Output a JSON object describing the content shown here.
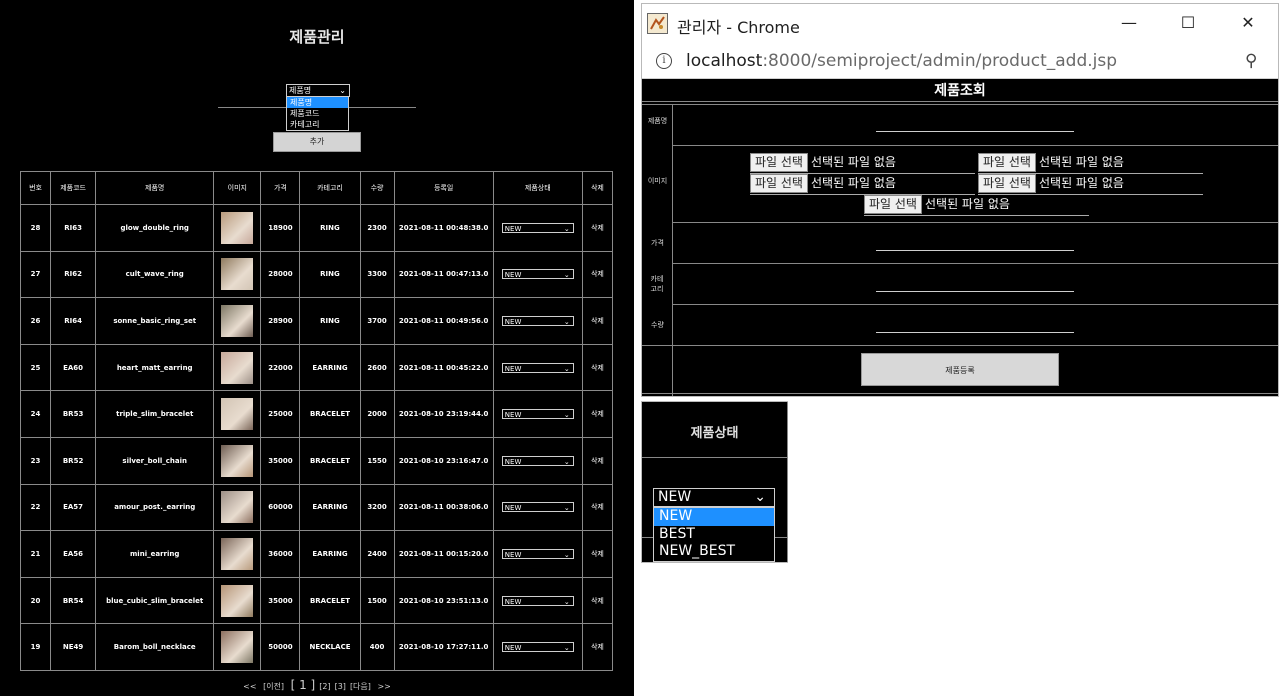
{
  "left": {
    "title": "제품관리",
    "search": {
      "selected": "제품명",
      "options": [
        "제품명",
        "제품코드",
        "카테고리"
      ]
    },
    "add_label": "추가",
    "table": {
      "headers": [
        "번호",
        "제품코드",
        "제품명",
        "이미지",
        "가격",
        "카테고리",
        "수량",
        "등록일",
        "제품상태",
        "삭제"
      ],
      "rows": [
        {
          "no": "28",
          "code": "RI63",
          "name": "glow_double_ring",
          "price": "18900",
          "category": "RING",
          "qty": "2300",
          "date": "2021-08-11 00:48:38.0",
          "status": "NEW",
          "del": "삭제"
        },
        {
          "no": "27",
          "code": "RI62",
          "name": "cult_wave_ring",
          "price": "28000",
          "category": "RING",
          "qty": "3300",
          "date": "2021-08-11 00:47:13.0",
          "status": "NEW",
          "del": "삭제"
        },
        {
          "no": "26",
          "code": "RI64",
          "name": "sonne_basic_ring_set",
          "price": "28900",
          "category": "RING",
          "qty": "3700",
          "date": "2021-08-11 00:49:56.0",
          "status": "NEW",
          "del": "삭제"
        },
        {
          "no": "25",
          "code": "EA60",
          "name": "heart_matt_earring",
          "price": "22000",
          "category": "EARRING",
          "qty": "2600",
          "date": "2021-08-11 00:45:22.0",
          "status": "NEW",
          "del": "삭제"
        },
        {
          "no": "24",
          "code": "BR53",
          "name": "triple_slim_bracelet",
          "price": "25000",
          "category": "BRACELET",
          "qty": "2000",
          "date": "2021-08-10 23:19:44.0",
          "status": "NEW",
          "del": "삭제"
        },
        {
          "no": "23",
          "code": "BR52",
          "name": "silver_boll_chain",
          "price": "35000",
          "category": "BRACELET",
          "qty": "1550",
          "date": "2021-08-10 23:16:47.0",
          "status": "NEW",
          "del": "삭제"
        },
        {
          "no": "22",
          "code": "EA57",
          "name": "amour_post._earring",
          "price": "60000",
          "category": "EARRING",
          "qty": "3200",
          "date": "2021-08-11 00:38:06.0",
          "status": "NEW",
          "del": "삭제"
        },
        {
          "no": "21",
          "code": "EA56",
          "name": "mini_earring",
          "price": "36000",
          "category": "EARRING",
          "qty": "2400",
          "date": "2021-08-11 00:15:20.0",
          "status": "NEW",
          "del": "삭제"
        },
        {
          "no": "20",
          "code": "BR54",
          "name": "blue_cubic_slim_bracelet",
          "price": "35000",
          "category": "BRACELET",
          "qty": "1500",
          "date": "2021-08-10 23:51:13.0",
          "status": "NEW",
          "del": "삭제"
        },
        {
          "no": "19",
          "code": "NE49",
          "name": "Barom_boll_necklace",
          "price": "50000",
          "category": "NECKLACE",
          "qty": "400",
          "date": "2021-08-10 17:27:11.0",
          "status": "NEW",
          "del": "삭제"
        }
      ]
    },
    "pager": {
      "first": "<<",
      "prev": "[이전]",
      "current": "[ 1 ]",
      "p2": "[2]",
      "p3": "[3]",
      "next": "[다음]",
      "last": ">>"
    }
  },
  "chrome": {
    "title": "관리자 - Chrome",
    "url_host": "localhost",
    "url_path": ":8000/semiproject/admin/product_add.jsp",
    "form_title": "제품조회",
    "labels": {
      "name": "제품명",
      "image": "이미지",
      "price": "가격",
      "category": "카테고리",
      "qty": "수량"
    },
    "file_button": "파일 선택",
    "file_none": "선택된 파일 없음",
    "register": "제품등록"
  },
  "status_popup": {
    "title": "제품상태",
    "selected": "NEW",
    "options": [
      "NEW",
      "BEST",
      "NEW_BEST"
    ]
  },
  "colors": {
    "highlight": "#1e90ff",
    "panel_bg": "#000000",
    "button_bg": "#d4d4d4"
  }
}
